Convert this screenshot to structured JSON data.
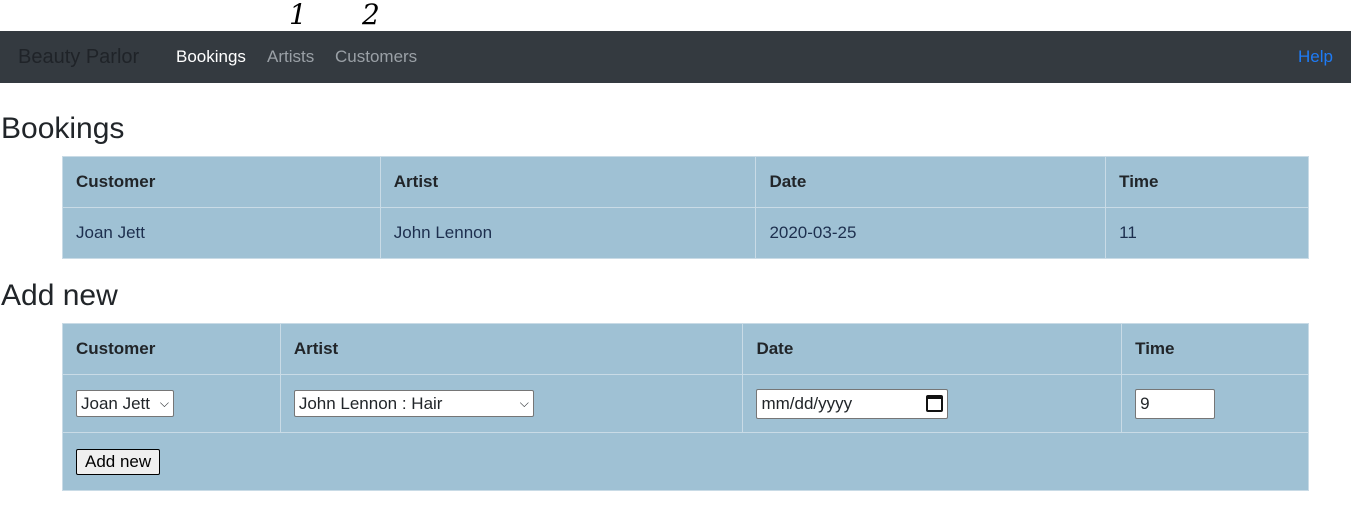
{
  "annotations": [
    "1",
    "2"
  ],
  "navbar": {
    "brand": "Beauty Parlor",
    "links": [
      "Bookings",
      "Artists",
      "Customers"
    ],
    "help": "Help"
  },
  "bookings": {
    "heading": "Bookings",
    "columns": [
      "Customer",
      "Artist",
      "Date",
      "Time"
    ],
    "rows": [
      [
        "Joan Jett",
        "John Lennon",
        "2020-03-25",
        "11"
      ]
    ]
  },
  "add_new": {
    "heading": "Add new",
    "columns": [
      "Customer",
      "Artist",
      "Date",
      "Time"
    ],
    "customer_selected": "Joan Jett",
    "artist_selected": "John Lennon : Hair",
    "date_placeholder": "mm/dd/yyyy",
    "time_value": "9",
    "submit_label": "Add new"
  },
  "colors": {
    "navbar_bg": "#343a40",
    "table_bg": "#9fc1d4",
    "help_link": "#1e7bf5"
  }
}
